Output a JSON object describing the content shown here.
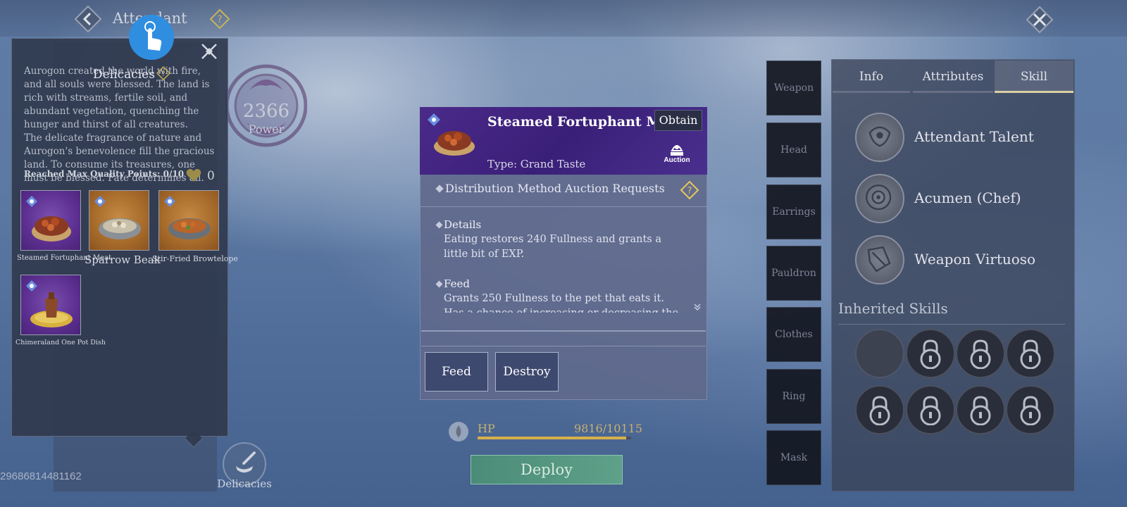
{
  "top_bar": {
    "title": "Attendant"
  },
  "user_id": "29686814481162",
  "power": {
    "value": "2366",
    "label": "Power"
  },
  "nav": {
    "delicacies_label": "Delicacies"
  },
  "delicacies_popup": {
    "title": "Delicacies",
    "lore": [
      "Aurogon created the world with fire, and all souls were blessed. The land is rich with streams, fertile soil, and abundant vegetation, quenching the hunger and thirst of all creatures.",
      "The delicate fragrance of nature and Aurogon's benevolence fill the gracious land. To consume its treasures, one must be blessed. Fate determines all."
    ],
    "max_quality": "Reached Max Quality Points: 0/10",
    "heart_count": "0",
    "items": [
      {
        "name": "Steamed Fortuphant Meat",
        "rarity": "purple"
      },
      {
        "name": "Sparrow Beak",
        "rarity": "orange"
      },
      {
        "name": "Stir-Fried Browtelope",
        "rarity": "orange"
      },
      {
        "name": "Chimeraland One Pot Dish",
        "rarity": "purple"
      }
    ]
  },
  "item_detail": {
    "name": "Steamed Fortuphant Meat",
    "obtain_label": "Obtain",
    "auction_label": "Auction",
    "type": "Type: Grand Taste",
    "distribution_label": "Distribution Method",
    "auction_requests_label": "Auction Requests",
    "details_title": "Details",
    "details_text": "Eating restores 240 Fullness and grants a little bit of EXP.",
    "feed_title": "Feed",
    "feed_text": "Grants 250 Fullness to the pet that eats it. Has a chance of increasing or decreasing the pet's",
    "feed_button": "Feed",
    "destroy_button": "Destroy"
  },
  "hp": {
    "label": "HP",
    "value": "9816/10115",
    "fraction": 0.97
  },
  "deploy_label": "Deploy",
  "equipment_slots": [
    "Weapon",
    "Head",
    "Earrings",
    "Pauldron",
    "Clothes",
    "Ring",
    "Mask"
  ],
  "right_panel": {
    "tabs": [
      "Info",
      "Attributes",
      "Skill"
    ],
    "active_tab": "Skill",
    "skills": [
      {
        "name": "Attendant Talent",
        "icon": "talent-icon"
      },
      {
        "name": "Acumen (Chef)",
        "icon": "acumen-icon"
      },
      {
        "name": "Weapon Virtuoso",
        "icon": "weapon-virtuoso-icon"
      }
    ],
    "inherited_title": "Inherited Skills",
    "inherited_slots": [
      "empty",
      "locked",
      "locked",
      "locked",
      "locked",
      "locked",
      "locked",
      "locked"
    ]
  },
  "colors": {
    "purple_rarity": "#5c2f90",
    "orange_rarity": "#a66a2a",
    "header_purple": "#3a1f78",
    "hp_fill": "#d7b04a",
    "deploy_green": "#5ea088"
  }
}
